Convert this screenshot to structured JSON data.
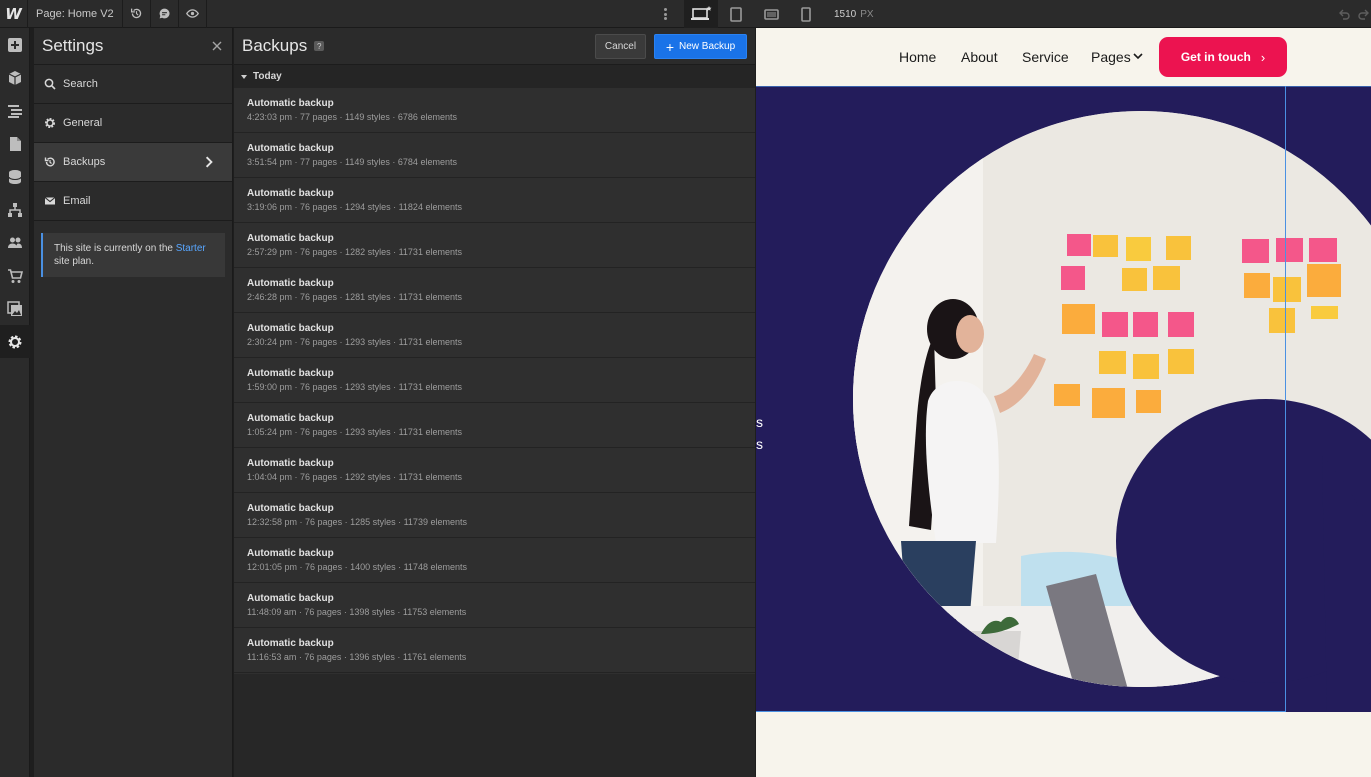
{
  "topbar": {
    "logo": "W",
    "page_label": "Page: Home V2",
    "width_value": "1510",
    "width_unit": "PX",
    "icons": [
      "undo-history-icon",
      "comment-icon",
      "preview-eye-icon",
      "more-vertical-icon",
      "desktop-star-icon",
      "tablet-icon",
      "mobile-landscape-icon",
      "mobile-portrait-icon",
      "undo-icon",
      "redo-icon"
    ]
  },
  "rail": {
    "icons": [
      "add-panel-icon",
      "components-icon",
      "navigator-icon",
      "pages-icon",
      "cms-icon",
      "logic-icon",
      "users-icon",
      "ecommerce-icon",
      "assets-icon",
      "settings-icon"
    ],
    "active": "settings-icon"
  },
  "settings": {
    "title": "Settings",
    "items": [
      {
        "label": "Search",
        "icon": "search-icon"
      },
      {
        "label": "General",
        "icon": "gear-icon"
      },
      {
        "label": "Backups",
        "icon": "backup-history-icon",
        "active": true
      },
      {
        "label": "Email",
        "icon": "email-icon"
      }
    ],
    "plan_note_pre": "This site is currently on the ",
    "plan_note_link": "Starter",
    "plan_note_post": " site plan."
  },
  "backups": {
    "title": "Backups",
    "help": "?",
    "cancel_label": "Cancel",
    "new_label": "New Backup",
    "group_label": "Today",
    "rows": [
      {
        "title": "Automatic backup",
        "meta": "4:23:03 pm · 77 pages · 1149 styles · 6786 elements"
      },
      {
        "title": "Automatic backup",
        "meta": "3:51:54 pm · 77 pages · 1149 styles · 6784 elements"
      },
      {
        "title": "Automatic backup",
        "meta": "3:19:06 pm · 76 pages · 1294 styles · 11824 elements"
      },
      {
        "title": "Automatic backup",
        "meta": "2:57:29 pm · 76 pages · 1282 styles · 11731 elements"
      },
      {
        "title": "Automatic backup",
        "meta": "2:46:28 pm · 76 pages · 1281 styles · 11731 elements"
      },
      {
        "title": "Automatic backup",
        "meta": "2:30:24 pm · 76 pages · 1293 styles · 11731 elements"
      },
      {
        "title": "Automatic backup",
        "meta": "1:59:00 pm · 76 pages · 1293 styles · 11731 elements"
      },
      {
        "title": "Automatic backup",
        "meta": "1:05:24 pm · 76 pages · 1293 styles · 11731 elements"
      },
      {
        "title": "Automatic backup",
        "meta": "1:04:04 pm · 76 pages · 1292 styles · 11731 elements"
      },
      {
        "title": "Automatic backup",
        "meta": "12:32:58 pm · 76 pages · 1285 styles · 11739 elements"
      },
      {
        "title": "Automatic backup",
        "meta": "12:01:05 pm · 76 pages · 1400 styles · 11748 elements"
      },
      {
        "title": "Automatic backup",
        "meta": "11:48:09 am · 76 pages · 1398 styles · 11753 elements"
      },
      {
        "title": "Automatic backup",
        "meta": "11:16:53 am · 76 pages · 1396 styles · 11761 elements"
      }
    ]
  },
  "preview": {
    "nav": [
      "Home",
      "About",
      "Service",
      "Pages"
    ],
    "cta_label": "Get in touch",
    "cta_arrow": "›",
    "hero_text_1": "s",
    "hero_text_2": "s",
    "colors": {
      "cta": "#ec1350",
      "hero_bg": "#231c5b",
      "page_bg": "#f7f4ec",
      "accent": "#1a73e8"
    }
  }
}
